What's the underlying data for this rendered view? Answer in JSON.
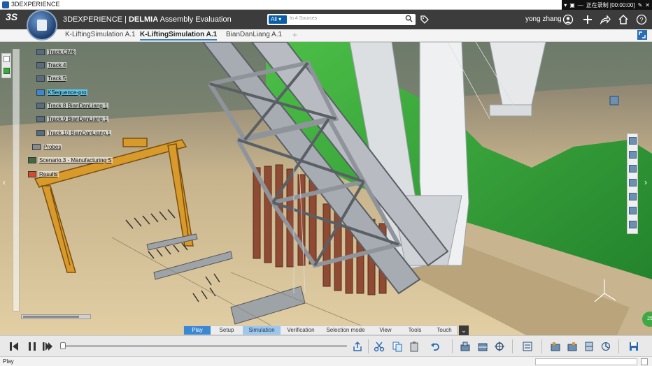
{
  "window": {
    "title": "3DEXPERIENCE",
    "recording_text": "正在录制 [00:00:00]"
  },
  "header": {
    "brand": "3DEXPERIENCE",
    "separator": "|",
    "product": "DELMIA",
    "app_name": "Assembly Evaluation",
    "search": {
      "scope": "All",
      "placeholder": "In 4 Sources"
    },
    "user": "yong zhang"
  },
  "tabs": [
    {
      "label": "K-LiftingSimulation A.1",
      "active": false
    },
    {
      "label": "K-LiftingSimulation A.1",
      "active": true
    },
    {
      "label": "BianDanLiang A.1",
      "active": false
    }
  ],
  "tree": {
    "items": [
      {
        "label": "Track.CM6"
      },
      {
        "label": "Track.4"
      },
      {
        "label": "Track.5"
      },
      {
        "label": "KSequence-pro",
        "selected": true
      },
      {
        "label": "Track.8  BianDanLiang.1"
      },
      {
        "label": "Track.9  BianDanLiang.1"
      },
      {
        "label": "Track.10  BianDanLiang.1"
      },
      {
        "label": "Probes"
      },
      {
        "label": "Scenario.3 - Manufacturing S"
      },
      {
        "label": "Results"
      }
    ]
  },
  "section_tabs": [
    {
      "label": "Play",
      "state": "active-a"
    },
    {
      "label": "Setup",
      "state": ""
    },
    {
      "label": "Simulation",
      "state": "active-b"
    },
    {
      "label": "Verification",
      "state": ""
    },
    {
      "label": "Selection mode",
      "state": ""
    },
    {
      "label": "View",
      "state": ""
    },
    {
      "label": "Tools",
      "state": ""
    },
    {
      "label": "Touch",
      "state": ""
    }
  ],
  "playback": {
    "progress": 0.0
  },
  "status": {
    "text": "Play"
  },
  "badge": {
    "text": "25"
  },
  "colors": {
    "accent": "#3a87d2",
    "header_bg": "#3c3c3c",
    "steel_truss": "#9a9fa6",
    "crane_yellow": "#d89a2a",
    "pier_rust": "#8e4a32",
    "terrain_green": "#39a23c",
    "ground_sand": "#d9c39a"
  }
}
